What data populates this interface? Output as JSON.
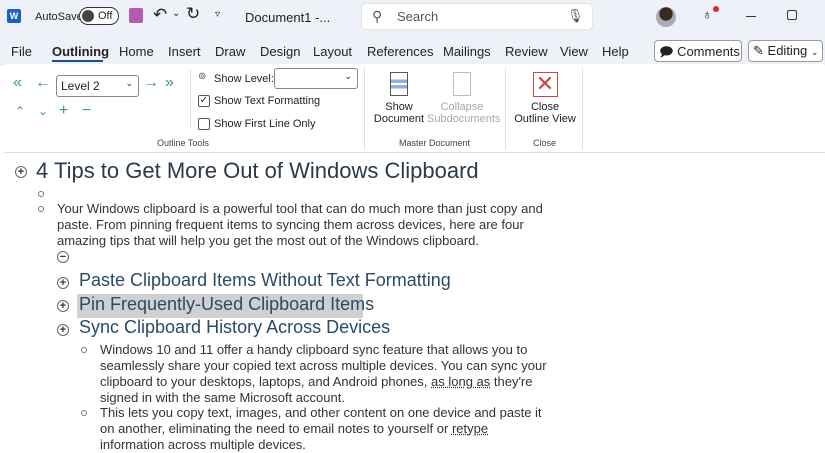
{
  "titlebar": {
    "autosave": "AutoSave",
    "autosave_state": "Off",
    "doc_title": "Document1 -...",
    "search_placeholder": "Search"
  },
  "tabs": [
    "File",
    "Outlining",
    "Home",
    "Insert",
    "Draw",
    "Design",
    "Layout",
    "References",
    "Mailings",
    "Review",
    "View",
    "Help"
  ],
  "active_tab": "Outlining",
  "buttons": {
    "comments": "Comments",
    "editing": "Editing"
  },
  "ribbon": {
    "level_value": "Level 2",
    "show_level_label": "Show Level:",
    "show_level_value": "",
    "show_text_formatting": "Show Text Formatting",
    "show_text_formatting_checked": true,
    "show_first_line_only": "Show First Line Only",
    "show_first_line_only_checked": false,
    "outline_tools": "Outline Tools",
    "show_document_1": "Show",
    "show_document_2": "Document",
    "collapse_1": "Collapse",
    "collapse_2": "Subdocuments",
    "master_document": "Master Document",
    "close_outline_1": "Close",
    "close_outline_2": "Outline View",
    "close_group": "Close"
  },
  "document": {
    "heading": "4 Tips to Get More Out of Windows Clipboard",
    "intro": [
      "Your Windows clipboard is a powerful tool that can do much more than just copy and",
      "paste. From pinning frequent items to syncing them across devices, here are four",
      "amazing tips that will help you get the most out of the Windows clipboard."
    ],
    "sub1": "Paste Clipboard Items Without Text Formatting",
    "sub2": "Pin Frequently-Used Clipboard Items",
    "sub3": "Sync Clipboard History Across Devices",
    "p1": [
      "Windows 10 and 11 offer a handy clipboard sync feature that allows you to",
      "seamlessly share your copied text across multiple devices. You can sync your",
      "clipboard to your desktops, laptops, and Android phones, ",
      "as long as",
      " they're",
      "signed in with the same Microsoft account."
    ],
    "p2": [
      "This lets you copy text, images, and other content on one device and paste it",
      "on another, eliminating the need to email notes to yourself or ",
      "retype",
      "information across multiple devices."
    ]
  }
}
